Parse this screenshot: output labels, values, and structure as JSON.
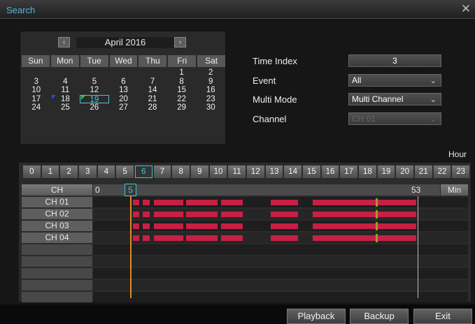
{
  "window": {
    "title": "Search",
    "close_icon": "close-icon"
  },
  "calendar": {
    "month_label": "April 2016",
    "prev_icon": "chevron-left-icon",
    "next_icon": "chevron-right-icon",
    "weekdays": [
      "Sun",
      "Mon",
      "Tue",
      "Wed",
      "Thu",
      "Fri",
      "Sat"
    ],
    "weeks": [
      [
        "",
        "",
        "",
        "",
        "",
        "1",
        "2"
      ],
      [
        "3",
        "4",
        "5",
        "6",
        "7",
        "8",
        "9"
      ],
      [
        "10",
        "11",
        "12",
        "13",
        "14",
        "15",
        "16"
      ],
      [
        "17",
        "18",
        "19",
        "20",
        "21",
        "22",
        "23"
      ],
      [
        "24",
        "25",
        "26",
        "27",
        "28",
        "29",
        "30"
      ]
    ],
    "selected_day": "19",
    "recorded_days": [
      "18",
      "19"
    ]
  },
  "form": {
    "time_index_label": "Time Index",
    "time_index_value": "3",
    "event_label": "Event",
    "event_value": "All",
    "multi_mode_label": "Multi Mode",
    "multi_mode_value": "Multi Channel",
    "channel_label": "Channel",
    "channel_value": "CH 01"
  },
  "timeline": {
    "hour_label": "Hour",
    "hours": [
      "0",
      "1",
      "2",
      "3",
      "4",
      "5",
      "6",
      "7",
      "8",
      "9",
      "10",
      "11",
      "12",
      "13",
      "14",
      "15",
      "16",
      "17",
      "18",
      "19",
      "20",
      "21",
      "22",
      "23"
    ],
    "active_hour": "6",
    "ch_header": "CH",
    "minute_start": "0",
    "minute_current": "5",
    "minute_end": "53",
    "min_label": "Min",
    "channels": [
      "CH 01",
      "CH 02",
      "CH 03",
      "CH 04"
    ],
    "empty_rows": 5
  },
  "buttons": {
    "playback": "Playback",
    "backup": "Backup",
    "exit": "Exit"
  },
  "colors": {
    "accent": "#3cc6d6",
    "recording": "#c81f45",
    "event_marker": "#9c9c2a",
    "cursor": "#e0892b",
    "title": "#4fb6e0"
  }
}
